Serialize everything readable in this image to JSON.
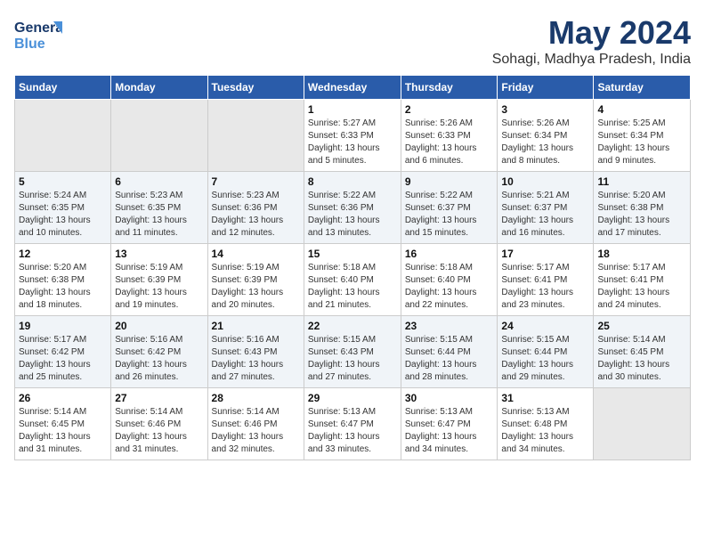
{
  "header": {
    "logo_general": "General",
    "logo_blue": "Blue",
    "main_title": "May 2024",
    "subtitle": "Sohagi, Madhya Pradesh, India"
  },
  "weekdays": [
    "Sunday",
    "Monday",
    "Tuesday",
    "Wednesday",
    "Thursday",
    "Friday",
    "Saturday"
  ],
  "weeks": [
    [
      {
        "day": "",
        "info": ""
      },
      {
        "day": "",
        "info": ""
      },
      {
        "day": "",
        "info": ""
      },
      {
        "day": "1",
        "info": "Sunrise: 5:27 AM\nSunset: 6:33 PM\nDaylight: 13 hours\nand 5 minutes."
      },
      {
        "day": "2",
        "info": "Sunrise: 5:26 AM\nSunset: 6:33 PM\nDaylight: 13 hours\nand 6 minutes."
      },
      {
        "day": "3",
        "info": "Sunrise: 5:26 AM\nSunset: 6:34 PM\nDaylight: 13 hours\nand 8 minutes."
      },
      {
        "day": "4",
        "info": "Sunrise: 5:25 AM\nSunset: 6:34 PM\nDaylight: 13 hours\nand 9 minutes."
      }
    ],
    [
      {
        "day": "5",
        "info": "Sunrise: 5:24 AM\nSunset: 6:35 PM\nDaylight: 13 hours\nand 10 minutes."
      },
      {
        "day": "6",
        "info": "Sunrise: 5:23 AM\nSunset: 6:35 PM\nDaylight: 13 hours\nand 11 minutes."
      },
      {
        "day": "7",
        "info": "Sunrise: 5:23 AM\nSunset: 6:36 PM\nDaylight: 13 hours\nand 12 minutes."
      },
      {
        "day": "8",
        "info": "Sunrise: 5:22 AM\nSunset: 6:36 PM\nDaylight: 13 hours\nand 13 minutes."
      },
      {
        "day": "9",
        "info": "Sunrise: 5:22 AM\nSunset: 6:37 PM\nDaylight: 13 hours\nand 15 minutes."
      },
      {
        "day": "10",
        "info": "Sunrise: 5:21 AM\nSunset: 6:37 PM\nDaylight: 13 hours\nand 16 minutes."
      },
      {
        "day": "11",
        "info": "Sunrise: 5:20 AM\nSunset: 6:38 PM\nDaylight: 13 hours\nand 17 minutes."
      }
    ],
    [
      {
        "day": "12",
        "info": "Sunrise: 5:20 AM\nSunset: 6:38 PM\nDaylight: 13 hours\nand 18 minutes."
      },
      {
        "day": "13",
        "info": "Sunrise: 5:19 AM\nSunset: 6:39 PM\nDaylight: 13 hours\nand 19 minutes."
      },
      {
        "day": "14",
        "info": "Sunrise: 5:19 AM\nSunset: 6:39 PM\nDaylight: 13 hours\nand 20 minutes."
      },
      {
        "day": "15",
        "info": "Sunrise: 5:18 AM\nSunset: 6:40 PM\nDaylight: 13 hours\nand 21 minutes."
      },
      {
        "day": "16",
        "info": "Sunrise: 5:18 AM\nSunset: 6:40 PM\nDaylight: 13 hours\nand 22 minutes."
      },
      {
        "day": "17",
        "info": "Sunrise: 5:17 AM\nSunset: 6:41 PM\nDaylight: 13 hours\nand 23 minutes."
      },
      {
        "day": "18",
        "info": "Sunrise: 5:17 AM\nSunset: 6:41 PM\nDaylight: 13 hours\nand 24 minutes."
      }
    ],
    [
      {
        "day": "19",
        "info": "Sunrise: 5:17 AM\nSunset: 6:42 PM\nDaylight: 13 hours\nand 25 minutes."
      },
      {
        "day": "20",
        "info": "Sunrise: 5:16 AM\nSunset: 6:42 PM\nDaylight: 13 hours\nand 26 minutes."
      },
      {
        "day": "21",
        "info": "Sunrise: 5:16 AM\nSunset: 6:43 PM\nDaylight: 13 hours\nand 27 minutes."
      },
      {
        "day": "22",
        "info": "Sunrise: 5:15 AM\nSunset: 6:43 PM\nDaylight: 13 hours\nand 27 minutes."
      },
      {
        "day": "23",
        "info": "Sunrise: 5:15 AM\nSunset: 6:44 PM\nDaylight: 13 hours\nand 28 minutes."
      },
      {
        "day": "24",
        "info": "Sunrise: 5:15 AM\nSunset: 6:44 PM\nDaylight: 13 hours\nand 29 minutes."
      },
      {
        "day": "25",
        "info": "Sunrise: 5:14 AM\nSunset: 6:45 PM\nDaylight: 13 hours\nand 30 minutes."
      }
    ],
    [
      {
        "day": "26",
        "info": "Sunrise: 5:14 AM\nSunset: 6:45 PM\nDaylight: 13 hours\nand 31 minutes."
      },
      {
        "day": "27",
        "info": "Sunrise: 5:14 AM\nSunset: 6:46 PM\nDaylight: 13 hours\nand 31 minutes."
      },
      {
        "day": "28",
        "info": "Sunrise: 5:14 AM\nSunset: 6:46 PM\nDaylight: 13 hours\nand 32 minutes."
      },
      {
        "day": "29",
        "info": "Sunrise: 5:13 AM\nSunset: 6:47 PM\nDaylight: 13 hours\nand 33 minutes."
      },
      {
        "day": "30",
        "info": "Sunrise: 5:13 AM\nSunset: 6:47 PM\nDaylight: 13 hours\nand 34 minutes."
      },
      {
        "day": "31",
        "info": "Sunrise: 5:13 AM\nSunset: 6:48 PM\nDaylight: 13 hours\nand 34 minutes."
      },
      {
        "day": "",
        "info": ""
      }
    ]
  ]
}
